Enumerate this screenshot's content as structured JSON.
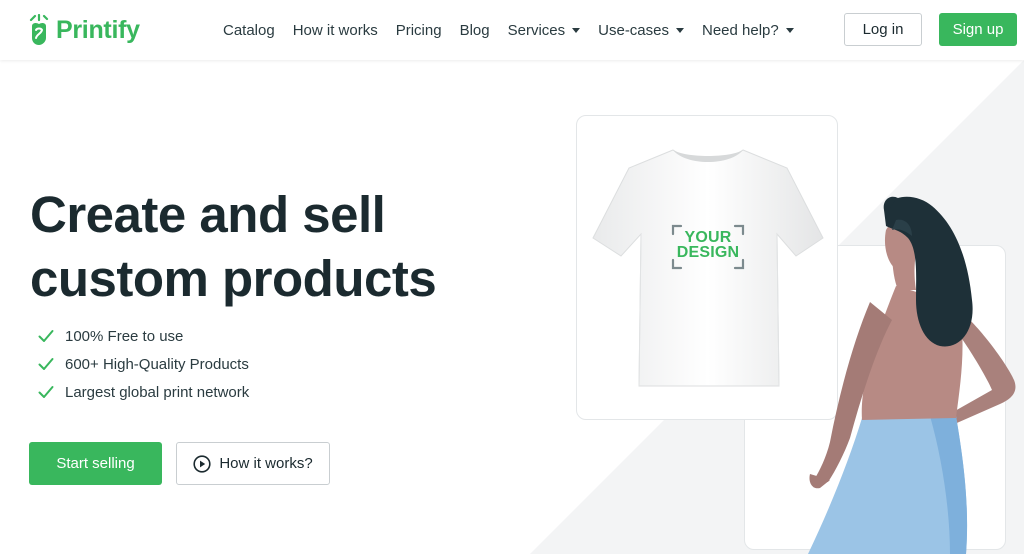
{
  "brand": {
    "name": "Printify",
    "color": "#39b75d"
  },
  "nav": {
    "items": [
      {
        "label": "Catalog",
        "dropdown": false
      },
      {
        "label": "How it works",
        "dropdown": false
      },
      {
        "label": "Pricing",
        "dropdown": false
      },
      {
        "label": "Blog",
        "dropdown": false
      },
      {
        "label": "Services",
        "dropdown": true
      },
      {
        "label": "Use-cases",
        "dropdown": true
      },
      {
        "label": "Need help?",
        "dropdown": true
      }
    ],
    "login_label": "Log in",
    "signup_label": "Sign up"
  },
  "hero": {
    "title_line1": "Create and sell",
    "title_line2": "custom products",
    "features": [
      "100% Free to use",
      "600+ High-Quality Products",
      "Largest global print network"
    ],
    "primary_cta": "Start selling",
    "secondary_cta": "How it works?"
  },
  "product": {
    "design_line1": "YOUR",
    "design_line2": "DESIGN"
  },
  "icons": {
    "logo": "printify-logo-icon",
    "check": "check-icon",
    "play": "play-circle-icon",
    "caret": "chevron-down-icon"
  },
  "colors": {
    "accent": "#39b75d",
    "text": "#1b2a2f",
    "hair": "#1e3038",
    "skin": "#b78a84",
    "skirt": "#9bc4e6"
  }
}
